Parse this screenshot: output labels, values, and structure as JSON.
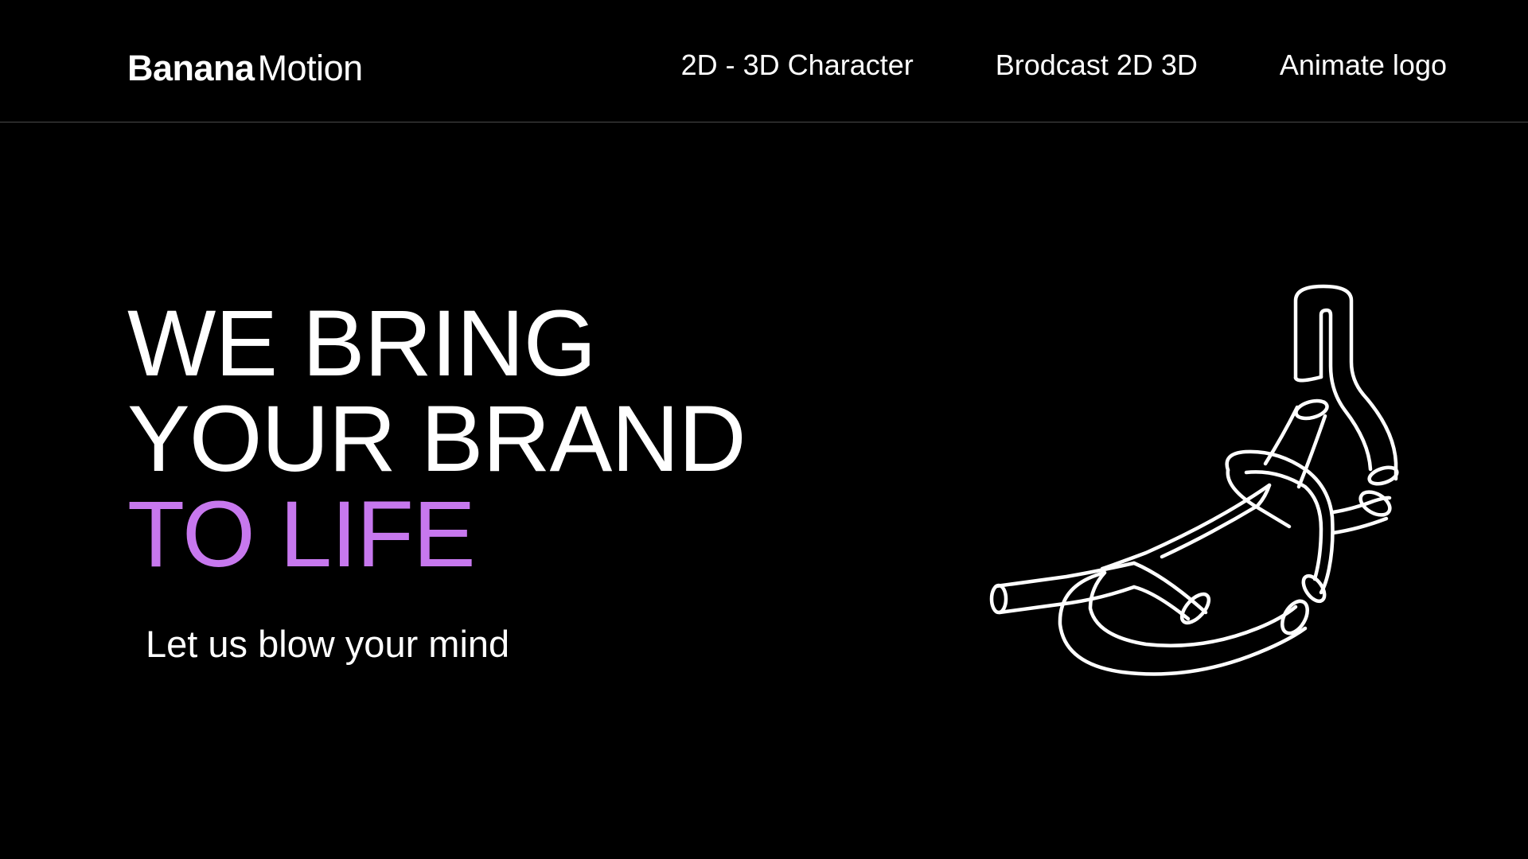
{
  "header": {
    "logo": {
      "bold": "Banana",
      "light": "Motion"
    },
    "nav": [
      {
        "label": "2D - 3D Character"
      },
      {
        "label": "Brodcast 2D 3D"
      },
      {
        "label": "Animate logo"
      }
    ]
  },
  "hero": {
    "line1": "WE BRING",
    "line2": "YOUR BRAND",
    "line3": "TO LIFE",
    "subtitle": "Let us blow your mind",
    "illustration_icon": "knotted-tube-icon"
  },
  "colors": {
    "background": "#000000",
    "text": "#ffffff",
    "accent": "#c778ee",
    "divider": "#4a4a4a"
  }
}
